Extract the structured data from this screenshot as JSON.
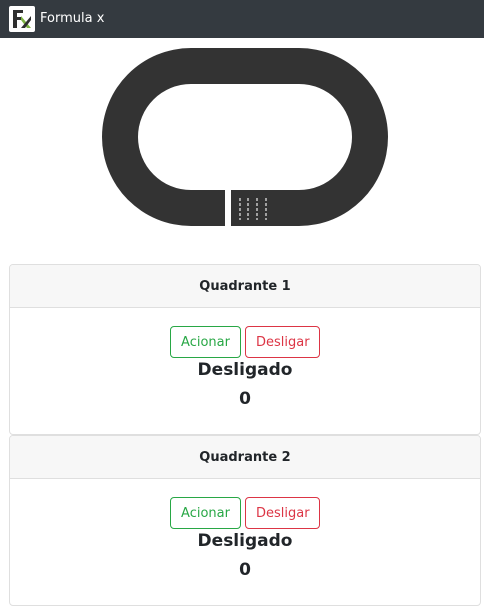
{
  "navbar": {
    "brand_text": "Formula x",
    "logo_icon": "formula-x-logo"
  },
  "track": {
    "icon": "race-track-icon",
    "track_color": "#333333",
    "line_color": "#bdbdbd"
  },
  "quadrants": [
    {
      "title": "Quadrante 1",
      "activate_label": "Acionar",
      "deactivate_label": "Desligar",
      "status": "Desligado",
      "count": "0"
    },
    {
      "title": "Quadrante 2",
      "activate_label": "Acionar",
      "deactivate_label": "Desligar",
      "status": "Desligado",
      "count": "0"
    }
  ],
  "colors": {
    "navbar": "#343a40",
    "success": "#28a745",
    "danger": "#dc3545",
    "card_header": "#f7f7f7"
  }
}
